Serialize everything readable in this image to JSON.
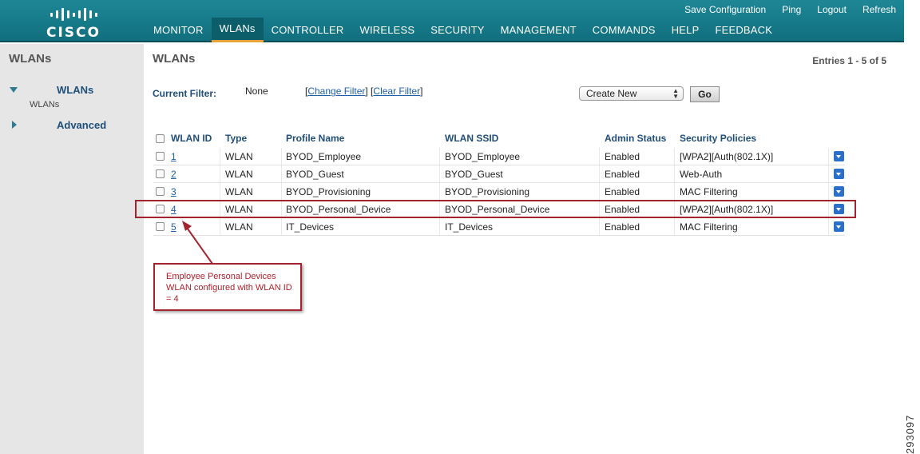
{
  "header": {
    "logo_text": "CISCO",
    "top_links": [
      "Save Configuration",
      "Ping",
      "Logout",
      "Refresh"
    ],
    "nav": [
      {
        "label": "MONITOR",
        "active": false
      },
      {
        "label": "WLANs",
        "active": true
      },
      {
        "label": "CONTROLLER",
        "active": false
      },
      {
        "label": "WIRELESS",
        "active": false
      },
      {
        "label": "SECURITY",
        "active": false
      },
      {
        "label": "MANAGEMENT",
        "active": false
      },
      {
        "label": "COMMANDS",
        "active": false
      },
      {
        "label": "HELP",
        "active": false
      },
      {
        "label": "FEEDBACK",
        "active": false
      }
    ]
  },
  "sidebar": {
    "title": "WLANs",
    "items": [
      {
        "label": "WLANs",
        "expanded": true,
        "sub": "WLANs"
      },
      {
        "label": "Advanced",
        "expanded": false
      }
    ]
  },
  "main": {
    "title": "WLANs",
    "entries": "Entries 1 - 5 of 5",
    "filter": {
      "label": "Current Filter:",
      "value": "None",
      "change": "Change Filter",
      "clear": "Clear Filter"
    },
    "action_select": "Create New",
    "go_label": "Go"
  },
  "table": {
    "headers": [
      "WLAN ID",
      "Type",
      "Profile Name",
      "WLAN SSID",
      "Admin Status",
      "Security Policies"
    ],
    "rows": [
      {
        "id": "1",
        "type": "WLAN",
        "profile": "BYOD_Employee",
        "ssid": "BYOD_Employee",
        "admin": "Enabled",
        "security": "[WPA2][Auth(802.1X)]"
      },
      {
        "id": "2",
        "type": "WLAN",
        "profile": "BYOD_Guest",
        "ssid": "BYOD_Guest",
        "admin": "Enabled",
        "security": "Web-Auth"
      },
      {
        "id": "3",
        "type": "WLAN",
        "profile": "BYOD_Provisioning",
        "ssid": "BYOD_Provisioning",
        "admin": "Enabled",
        "security": "MAC Filtering"
      },
      {
        "id": "4",
        "type": "WLAN",
        "profile": "BYOD_Personal_Device",
        "ssid": "BYOD_Personal_Device",
        "admin": "Enabled",
        "security": "[WPA2][Auth(802.1X)]"
      },
      {
        "id": "5",
        "type": "WLAN",
        "profile": "IT_Devices",
        "ssid": "IT_Devices",
        "admin": "Enabled",
        "security": "MAC Filtering"
      }
    ]
  },
  "annotation": {
    "callout_text": "Employee Personal Devices WLAN configured with WLAN ID = 4",
    "color": "#a3232f"
  },
  "figure_id": "293097",
  "colors": {
    "header": "#16798a",
    "active_tab_underline": "#e8a23a",
    "link": "#1f5fa8",
    "label": "#1f4e79"
  }
}
